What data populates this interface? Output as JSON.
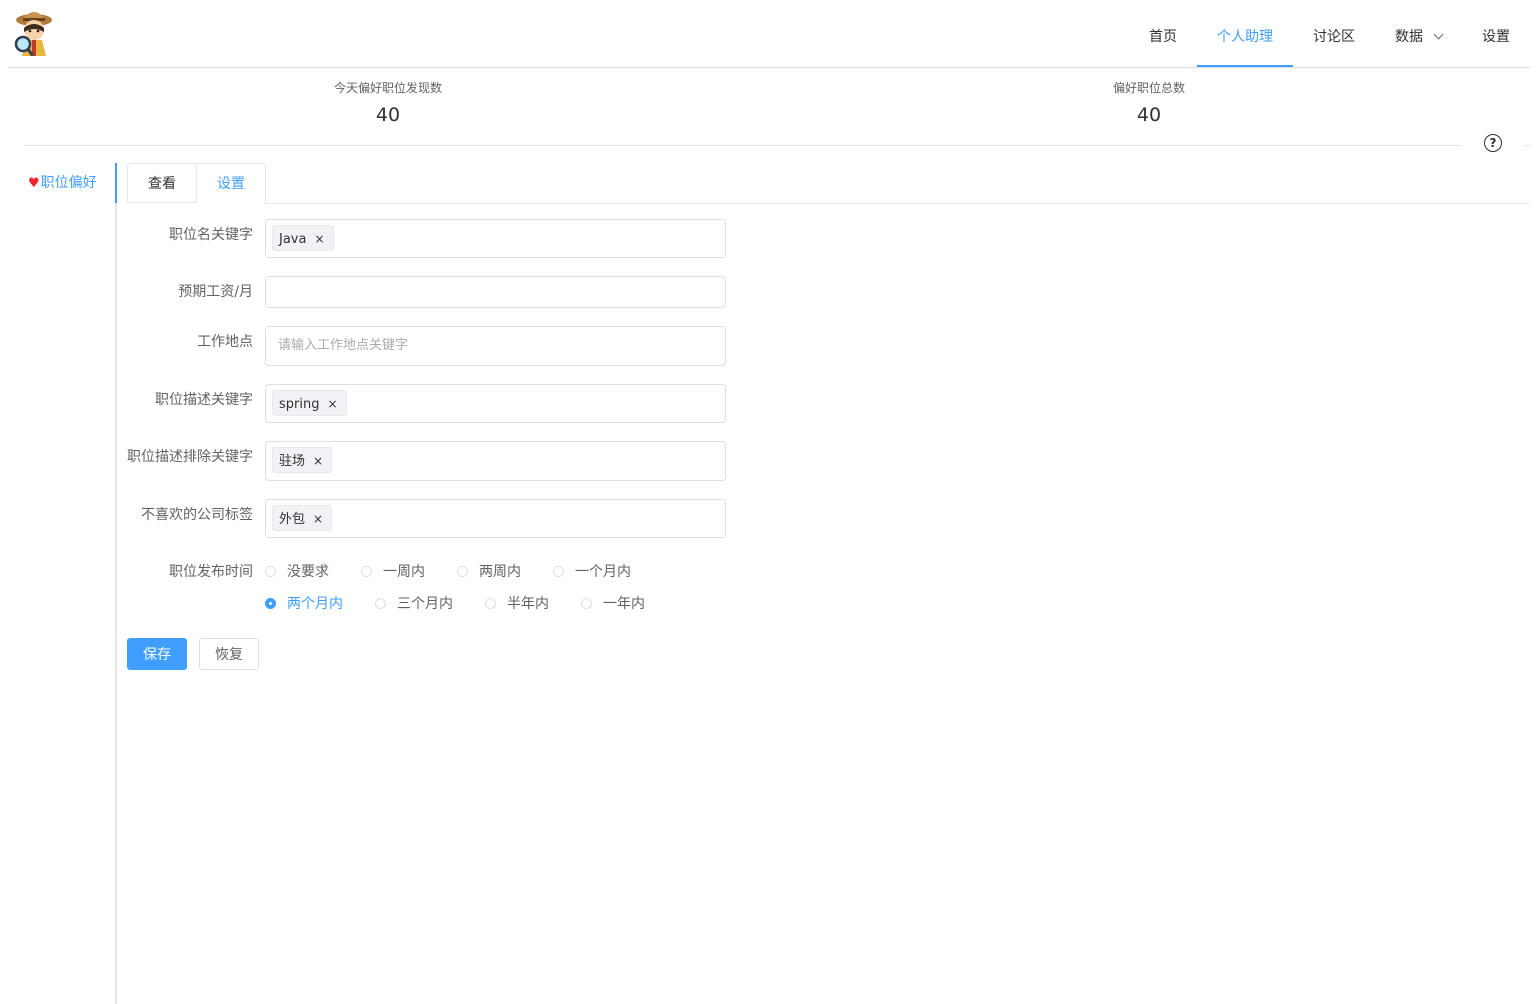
{
  "header": {
    "nav": [
      {
        "label": "首页",
        "active": false
      },
      {
        "label": "个人助理",
        "active": true
      },
      {
        "label": "讨论区",
        "active": false
      },
      {
        "label": "数据",
        "active": false,
        "dropdown": true
      },
      {
        "label": "设置",
        "active": false
      }
    ]
  },
  "stats": [
    {
      "label": "今天偏好职位发现数",
      "value": "40"
    },
    {
      "label": "偏好职位总数",
      "value": "40"
    }
  ],
  "help_icon": "?",
  "sidebar": {
    "items": [
      {
        "icon": "♥",
        "label": "职位偏好"
      }
    ]
  },
  "tabs": [
    {
      "label": "查看",
      "active": false
    },
    {
      "label": "设置",
      "active": true
    }
  ],
  "form": {
    "job_keywords": {
      "label": "职位名关键字",
      "tags": [
        "Java"
      ]
    },
    "salary": {
      "label": "预期工资/月",
      "value": ""
    },
    "location": {
      "label": "工作地点",
      "placeholder": "请输入工作地点关键字"
    },
    "desc_keywords": {
      "label": "职位描述关键字",
      "tags": [
        "spring"
      ]
    },
    "desc_exclude": {
      "label": "职位描述排除关键字",
      "tags": [
        "驻场"
      ]
    },
    "company_tags": {
      "label": "不喜欢的公司标签",
      "tags": [
        "外包"
      ]
    },
    "publish_time": {
      "label": "职位发布时间",
      "options": [
        "没要求",
        "一周内",
        "两周内",
        "一个月内",
        "两个月内",
        "三个月内",
        "半年内",
        "一年内"
      ],
      "selected": "两个月内"
    }
  },
  "buttons": {
    "save": "保存",
    "reset": "恢复"
  },
  "colors": {
    "primary": "#409eff",
    "heart": "#f5222d",
    "border": "#dcdfe6"
  },
  "tag_close": "×"
}
